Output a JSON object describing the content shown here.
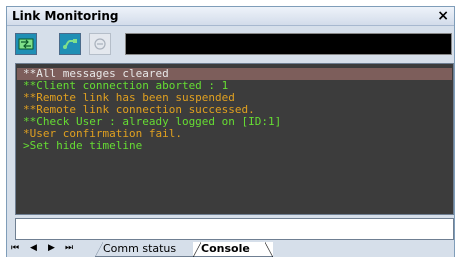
{
  "window": {
    "title": "Link Monitoring",
    "close_glyph": "×"
  },
  "toolbar": {
    "buttons": [
      {
        "icon": "link-icon",
        "state": "active"
      },
      {
        "icon": "cable-icon",
        "state": "normal"
      },
      {
        "icon": "power-icon",
        "state": "disabled"
      }
    ],
    "status_text": ""
  },
  "console": {
    "messages": [
      {
        "text": "**All messages cleared",
        "color": "#e8e8e8",
        "highlight": true
      },
      {
        "text": "**Client connection aborted : 1",
        "color": "#66dd33",
        "highlight": false
      },
      {
        "text": "**Remote link has been suspended",
        "color": "#e0a020",
        "highlight": false
      },
      {
        "text": "**Remote link connection successed.",
        "color": "#e0a020",
        "highlight": false
      },
      {
        "text": "**Check User : already logged on [ID:1]",
        "color": "#66dd33",
        "highlight": false
      },
      {
        "text": "*User confirmation fail.",
        "color": "#e0a020",
        "highlight": false
      },
      {
        "text": ">Set hide timeline",
        "color": "#66dd33",
        "highlight": false
      }
    ],
    "input_value": ""
  },
  "tabs": {
    "nav": [
      "⏮",
      "◀",
      "▶",
      "⏭"
    ],
    "items": [
      {
        "label": "Comm status",
        "selected": false
      },
      {
        "label": "Console",
        "selected": true
      }
    ]
  }
}
